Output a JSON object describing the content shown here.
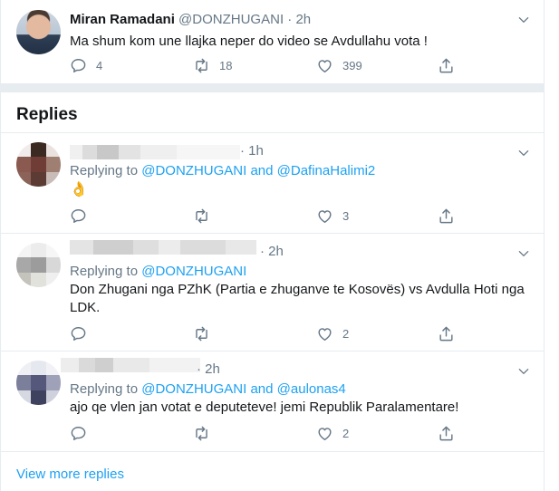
{
  "main_tweet": {
    "name": "Miran Ramadani",
    "handle": "@DONZHUGANI",
    "dot": "·",
    "time": "2h",
    "text": "Ma shum kom une llajka neper do video se Avdullahu vota !",
    "reply_count": "4",
    "retweet_count": "18",
    "like_count": "399"
  },
  "replies_title": "Replies",
  "replies": [
    {
      "time": "· 1h",
      "replying_prefix": "Replying to ",
      "mention1": "@DONZHUGANI",
      "and": " and ",
      "mention2": "@DafinaHalimi2",
      "text": "",
      "emoji": "👌",
      "reply_count": "",
      "retweet_count": "",
      "like_count": "3"
    },
    {
      "time": "· 2h",
      "replying_prefix": "Replying to ",
      "mention1": "@DONZHUGANI",
      "text_line1": "Don Zhugani nga PZhK (Partia e zhuganve te Kosovës) vs Avdulla Hoti nga",
      "text_line2": "LDK.",
      "like_count": "2"
    },
    {
      "time": "· 2h",
      "replying_prefix": "Replying to ",
      "mention1": "@DONZHUGANI",
      "and": " and ",
      "mention2": "@aulonas4",
      "text": "ajo qe vlen jan votat e deputeteve! jemi Republik Paralamentare!",
      "like_count": "2"
    }
  ],
  "view_more": "View more replies",
  "colors": {
    "link": "#1da1f2",
    "secondary": "#657786",
    "divider": "#e6ecf0"
  },
  "icons": [
    "chevron-down-icon",
    "reply-icon",
    "retweet-icon",
    "like-icon",
    "share-icon"
  ]
}
